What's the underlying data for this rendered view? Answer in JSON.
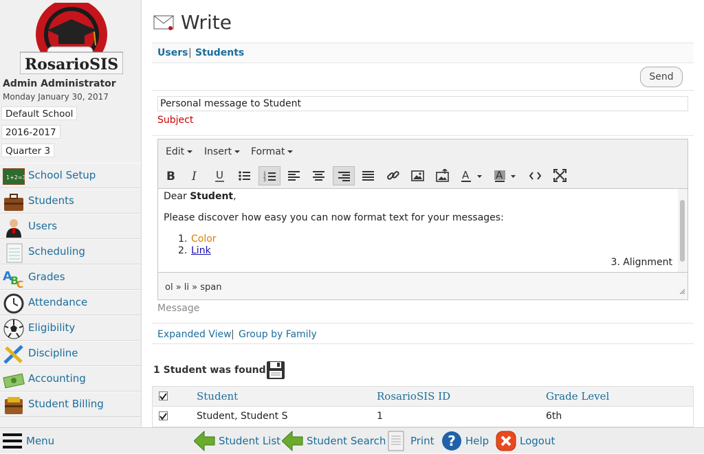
{
  "app": {
    "logo_text": "RosarioSIS"
  },
  "user": {
    "name": "Admin Administrator",
    "date": "Monday January 30, 2017"
  },
  "selectors": {
    "school": "Default School",
    "year": "2016-2017",
    "period": "Quarter 3"
  },
  "sidebar": {
    "items": [
      {
        "label": "School Setup",
        "icon": "school-setup-icon"
      },
      {
        "label": "Students",
        "icon": "students-briefcase-icon"
      },
      {
        "label": "Users",
        "icon": "users-icon"
      },
      {
        "label": "Scheduling",
        "icon": "scheduling-notebook-icon"
      },
      {
        "label": "Grades",
        "icon": "grades-abc-icon"
      },
      {
        "label": "Attendance",
        "icon": "attendance-clock-icon"
      },
      {
        "label": "Eligibility",
        "icon": "eligibility-ball-icon"
      },
      {
        "label": "Discipline",
        "icon": "discipline-pencil-icon"
      },
      {
        "label": "Accounting",
        "icon": "accounting-money-icon"
      },
      {
        "label": "Student Billing",
        "icon": "student-billing-icon"
      }
    ]
  },
  "page": {
    "title": "Write",
    "icon": "envelope-icon"
  },
  "tabs": {
    "users": "Users",
    "separator": "|",
    "students": "Students"
  },
  "actions": {
    "send": "Send"
  },
  "subject": {
    "value": "Personal message to Student",
    "label": "Subject"
  },
  "editor": {
    "menus": [
      "Edit",
      "Insert",
      "Format"
    ],
    "greeting_prefix": "Dear ",
    "greeting_bold": "Student",
    "greeting_suffix": ",",
    "intro": "Please discover how easy you can now format text for your messages:",
    "list": {
      "item1": "Color",
      "item2": "Link",
      "item3": "Alignment"
    },
    "list_numbers": {
      "n1": "1.",
      "n2": "2.",
      "n3": "3."
    },
    "color_item_color": "#e07b00",
    "path": "ol » li » span"
  },
  "message_label": "Message",
  "views": {
    "expanded": "Expanded View",
    "separator": "|",
    "group": "Group by Family"
  },
  "results": {
    "found": "1 Student was found."
  },
  "table": {
    "headers": {
      "student": "Student",
      "id": "RosarioSIS ID",
      "grade": "Grade Level"
    },
    "rows": [
      {
        "checked": true,
        "student": "Student, Student S",
        "id": "1",
        "grade": "6th"
      }
    ]
  },
  "bottombar": {
    "menu": "Menu",
    "student_list": "Student List",
    "student_search": "Student Search",
    "print": "Print",
    "help": "Help",
    "logout": "Logout"
  },
  "colors": {
    "link": "#1b6d9b",
    "required": "#cc0000",
    "accent_green": "#5c9e2a",
    "logout_red": "#e8491e"
  }
}
